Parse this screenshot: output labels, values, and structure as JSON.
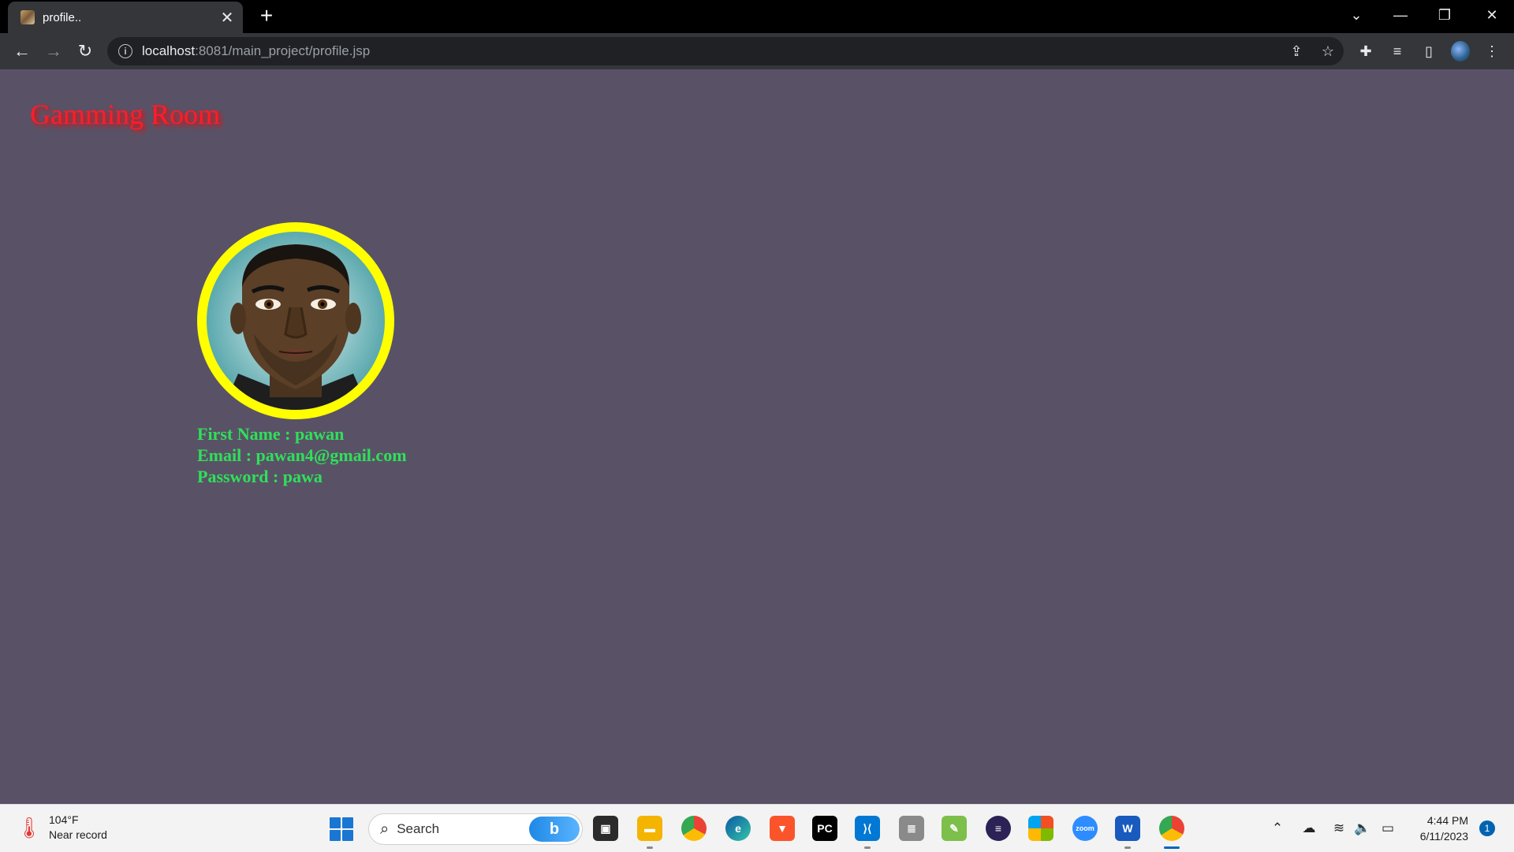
{
  "browser": {
    "tab_title": "profile..",
    "url_host": "localhost",
    "url_path": ":8081/main_project/profile.jsp"
  },
  "page": {
    "brand": "Gamming Room",
    "first_name_line": "First Name : pawan",
    "email_line": "Email : pawan4@gmail.com",
    "password_line": "Password : pawa"
  },
  "taskbar": {
    "weather_temp": "104°F",
    "weather_desc": "Near record",
    "search_label": "Search",
    "time": "4:44 PM",
    "date": "6/11/2023",
    "notification_count": "1",
    "zoom_label": "zoom"
  },
  "colors": {
    "page_background": "#595266",
    "brand_color": "#ff1d2a",
    "info_text_color": "#2fe05a",
    "avatar_ring": "#ffff00"
  },
  "icons": [
    "back-icon",
    "forward-icon",
    "reload-icon",
    "info-icon",
    "share-icon",
    "star-icon",
    "extensions-icon",
    "media-icon",
    "sidepanel-icon",
    "profile-icon",
    "menu-icon"
  ]
}
